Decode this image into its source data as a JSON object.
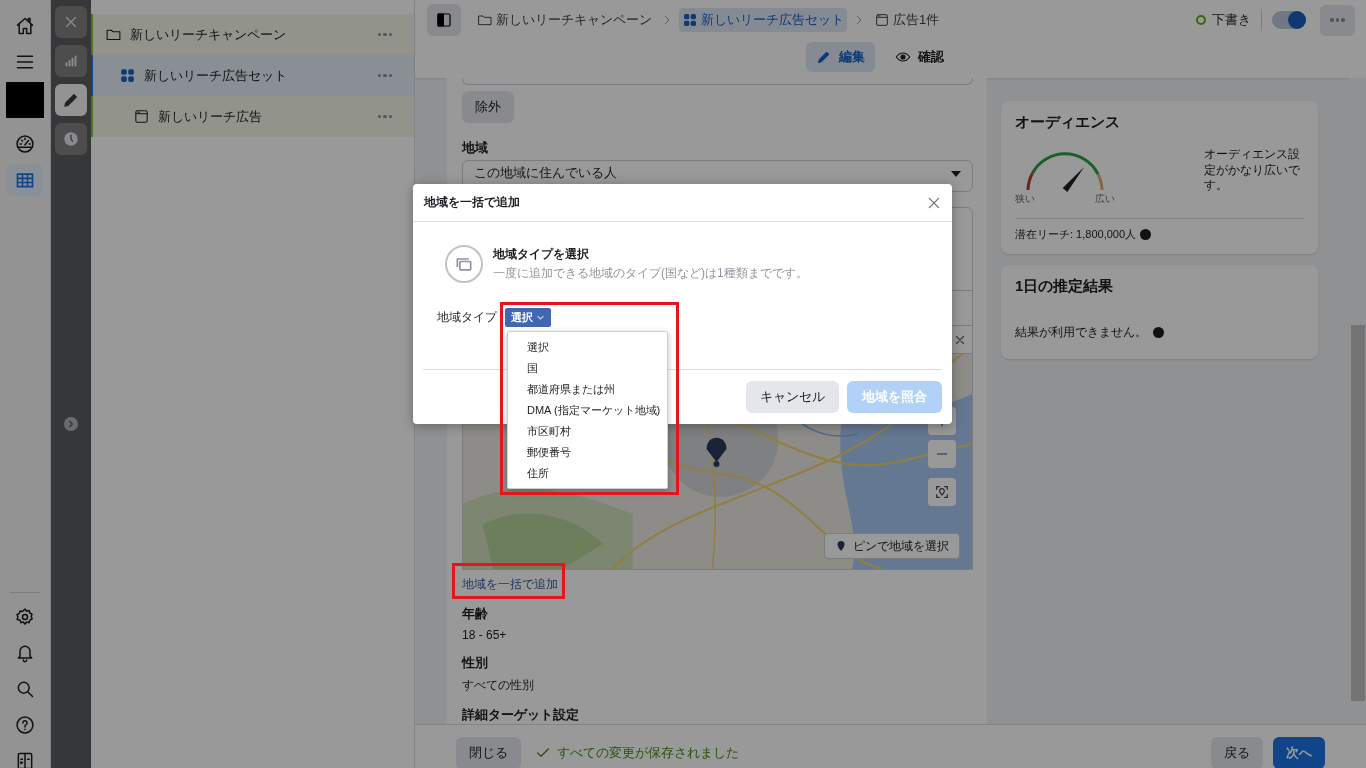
{
  "rail": [
    {
      "kind": "home",
      "selected": false
    },
    {
      "kind": "menu",
      "selected": false
    },
    {
      "kind": "account",
      "selected": false
    },
    {
      "kind": "gauge",
      "selected": false
    },
    {
      "kind": "table",
      "selected": true
    }
  ],
  "rail_bottom": [
    {
      "kind": "settings"
    },
    {
      "kind": "bell"
    },
    {
      "kind": "search"
    },
    {
      "kind": "help"
    },
    {
      "kind": "panel"
    }
  ],
  "tools": [
    {
      "kind": "close",
      "selected": false
    },
    {
      "kind": "chart",
      "selected": false
    },
    {
      "kind": "edit",
      "selected": true
    },
    {
      "kind": "history",
      "selected": false
    }
  ],
  "tree": [
    {
      "kind": "campaign",
      "label": "新しいリーチキャンペーン",
      "selected": false,
      "children": [
        {
          "kind": "adset",
          "label": "新しいリーチ広告セット",
          "selected": true,
          "children": [
            {
              "kind": "ad",
              "label": "新しいリーチ広告",
              "selected": false
            }
          ]
        }
      ]
    }
  ],
  "breadcrumb": [
    {
      "kind": "campaign",
      "label": "新しいリーチキャンペーン",
      "selected": false
    },
    {
      "kind": "adset",
      "label": "新しいリーチ広告セット",
      "selected": true
    },
    {
      "kind": "ad",
      "label": "広告1件",
      "selected": false
    }
  ],
  "status": {
    "label": "下書き",
    "on": true
  },
  "view_tabs": [
    {
      "kind": "edit",
      "label": "編集",
      "selected": true
    },
    {
      "kind": "view",
      "label": "確認",
      "selected": false
    }
  ],
  "form": {
    "exclude_button": "除外",
    "location_label": "地域",
    "location_select": "この地域に住んでいる人",
    "map_button": "ピンで地域を選択",
    "bulk_link": "地域を一括で追加",
    "age_label": "年齢",
    "age_value": "18 - 65+",
    "gender_label": "性別",
    "gender_value": "すべての性別",
    "detailed_label": "詳細ターゲット設定"
  },
  "audience": {
    "title": "オーディエンス",
    "level": 0.72,
    "narrow": "狭い",
    "wide": "広い",
    "description": "オーディエンス設定がかなり広いです。",
    "reach": "潜在リーチ: 1,800,000人"
  },
  "estimate": {
    "title": "1日の推定結果",
    "message": "結果が利用できません。"
  },
  "dialog": {
    "title": "地域を一括で追加",
    "heading": "地域タイプを選択",
    "subtext": "一度に追加できる地域のタイプ(国など)は1種類までです。",
    "field_label": "地域タイプ",
    "select_value": "選択",
    "options": [
      "選択",
      "国",
      "都道府県または州",
      "DMA (指定マーケット地域)",
      "市区町村",
      "郵便番号",
      "住所"
    ],
    "cancel": "キャンセル",
    "confirm": {
      "label": "地域を照合",
      "disabled": true
    }
  },
  "footer": {
    "close": "閉じる",
    "saved": "すべての変更が保存されました",
    "back": "戻る",
    "next": "次へ"
  }
}
